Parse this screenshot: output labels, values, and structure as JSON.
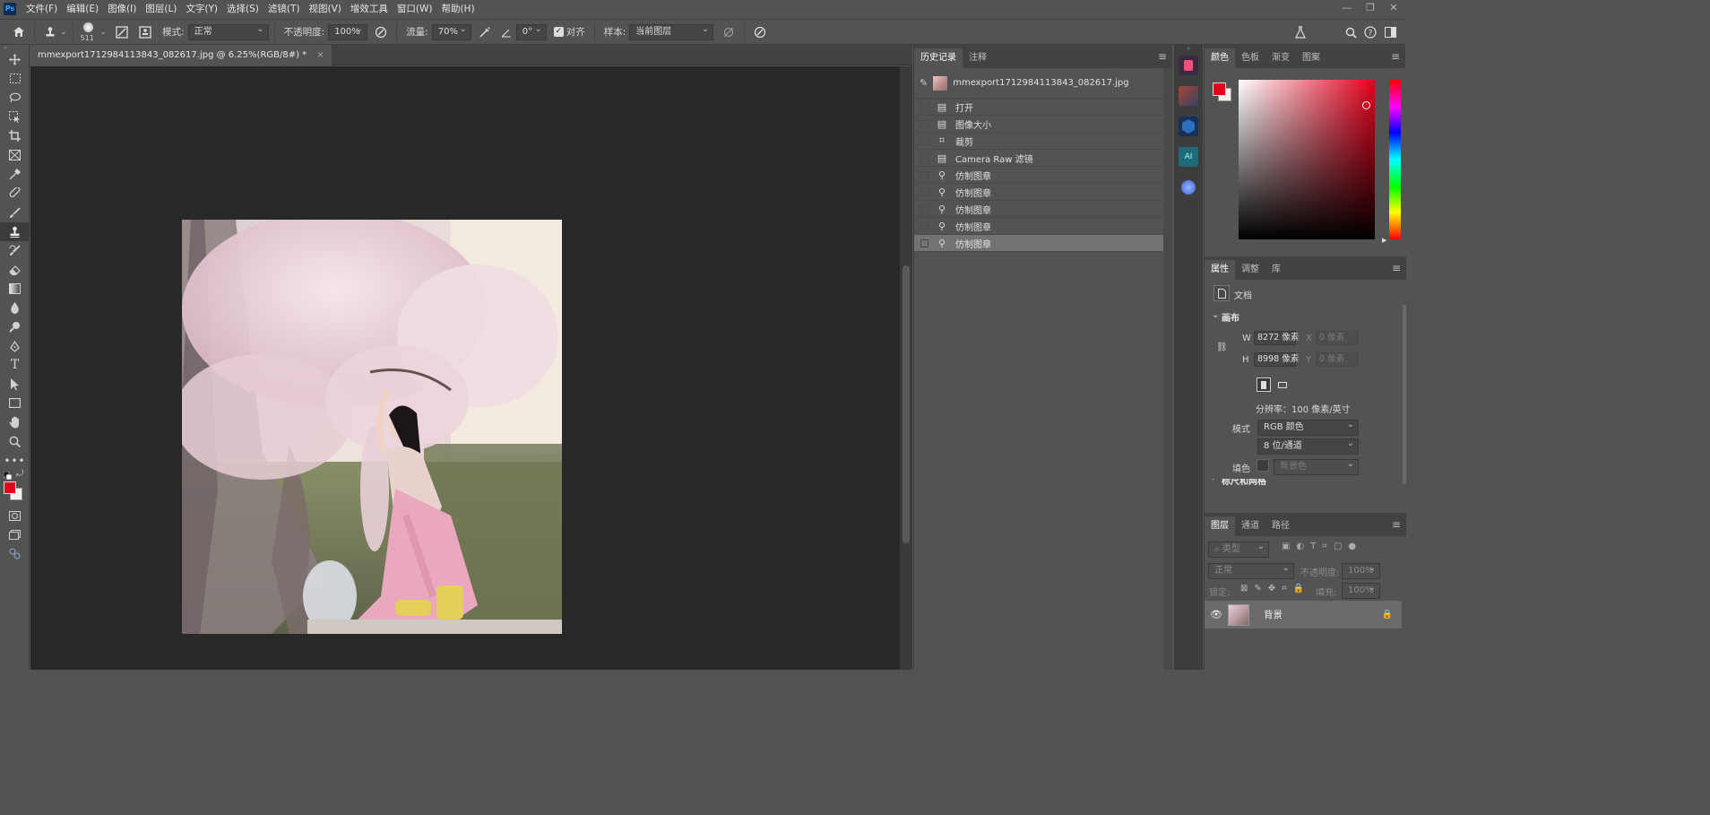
{
  "app": {
    "logo": "Ps"
  },
  "menu": [
    "文件(F)",
    "编辑(E)",
    "图像(I)",
    "图层(L)",
    "文字(Y)",
    "选择(S)",
    "滤镜(T)",
    "视图(V)",
    "增效工具",
    "窗口(W)",
    "帮助(H)"
  ],
  "options": {
    "brush_size": "511",
    "mode_label": "模式:",
    "mode_value": "正常",
    "opacity_label": "不透明度:",
    "opacity_value": "100%",
    "flow_label": "流量:",
    "flow_value": "70%",
    "angle_value": "0°",
    "align_label": "对齐",
    "sample_label": "样本:",
    "sample_value": "当前图层"
  },
  "document": {
    "tab_title": "mmexport1712984113843_082617.jpg @ 6.25%(RGB/8#) *"
  },
  "history": {
    "tabs": [
      "历史记录",
      "注释"
    ],
    "snapshot_name": "mmexport1712984113843_082617.jpg",
    "items": [
      {
        "icon": "doc-icon",
        "label": "打开"
      },
      {
        "icon": "doc-icon",
        "label": "图像大小"
      },
      {
        "icon": "crop-icon",
        "label": "裁剪"
      },
      {
        "icon": "doc-icon",
        "label": "Camera Raw 滤镜"
      },
      {
        "icon": "stamp-icon",
        "label": "仿制图章"
      },
      {
        "icon": "stamp-icon",
        "label": "仿制图章"
      },
      {
        "icon": "stamp-icon",
        "label": "仿制图章"
      },
      {
        "icon": "stamp-icon",
        "label": "仿制图章"
      },
      {
        "icon": "stamp-icon",
        "label": "仿制图章"
      }
    ]
  },
  "color_panel": {
    "tabs": [
      "颜色",
      "色板",
      "渐变",
      "图案"
    ],
    "foreground": "#e3001b",
    "background": "#f5f1ea"
  },
  "properties": {
    "tabs": [
      "属性",
      "调整",
      "库"
    ],
    "doc_label": "文档",
    "canvas_label": "画布",
    "w_label": "W",
    "w_value": "8272 像素",
    "h_label": "H",
    "h_value": "8998 像素",
    "x_label": "X",
    "x_value": "0 像素",
    "y_label": "Y",
    "y_value": "0 像素",
    "resolution": "分辨率：100 像素/英寸",
    "mode_label": "模式",
    "mode_value": "RGB 颜色",
    "depth_value": "8 位/通道",
    "fill_label": "填色",
    "fill_value": "背景色",
    "next_section": "标尺和网格"
  },
  "layers": {
    "tabs": [
      "图层",
      "通道",
      "路径"
    ],
    "filter_placeholder": "类型",
    "blend_value": "正常",
    "opacity_label": "不透明度:",
    "opacity_value": "100%",
    "lock_label": "锁定:",
    "fill_label": "填充:",
    "fill_value": "100%",
    "layer_name": "背景"
  }
}
